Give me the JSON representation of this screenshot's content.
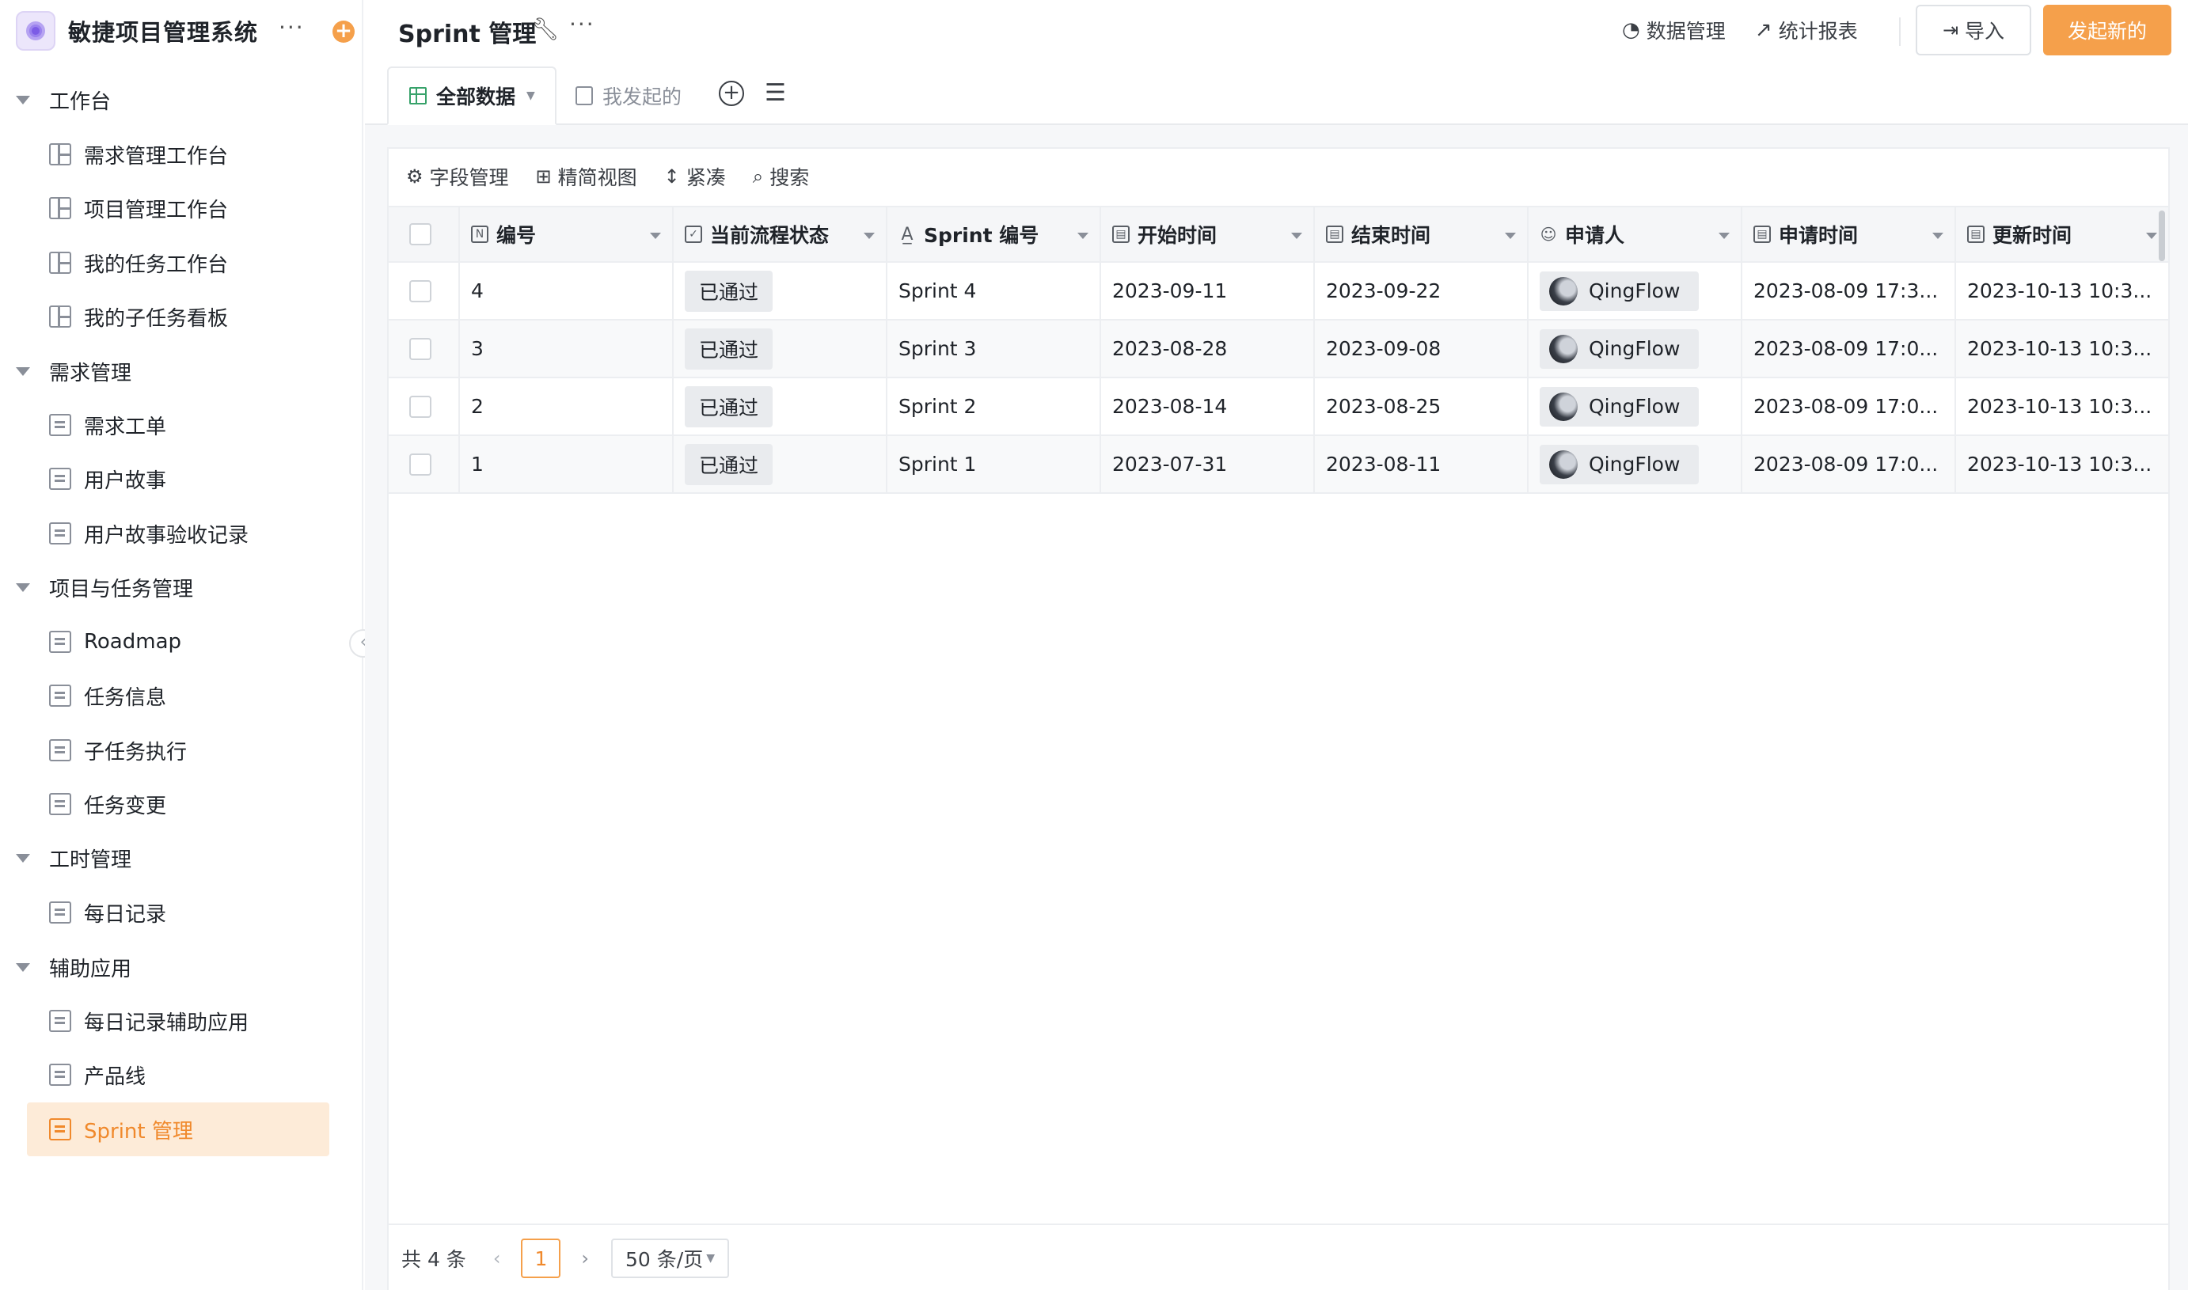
{
  "app": {
    "title": "敏捷项目管理系统",
    "more": "···",
    "add": "+"
  },
  "sidebar": {
    "groups": [
      {
        "label": "工作台"
      },
      {
        "label": "需求管理"
      },
      {
        "label": "项目与任务管理"
      },
      {
        "label": "工时管理"
      },
      {
        "label": "辅助应用"
      }
    ],
    "items": [
      {
        "label": "需求管理工作台",
        "icon": "dashboard-icon"
      },
      {
        "label": "项目管理工作台",
        "icon": "dashboard-icon"
      },
      {
        "label": "我的任务工作台",
        "icon": "dashboard-icon"
      },
      {
        "label": "我的子任务看板",
        "icon": "dashboard-icon"
      },
      {
        "label": "需求工单",
        "icon": "form-icon"
      },
      {
        "label": "用户故事",
        "icon": "form-icon"
      },
      {
        "label": "用户故事验收记录",
        "icon": "form-icon"
      },
      {
        "label": "Roadmap",
        "icon": "form-icon"
      },
      {
        "label": "任务信息",
        "icon": "form-icon"
      },
      {
        "label": "子任务执行",
        "icon": "form-icon"
      },
      {
        "label": "任务变更",
        "icon": "form-icon"
      },
      {
        "label": "每日记录",
        "icon": "form-icon"
      },
      {
        "label": "每日记录辅助应用",
        "icon": "form-icon"
      },
      {
        "label": "产品线",
        "icon": "form-icon"
      },
      {
        "label": "Sprint 管理",
        "icon": "form-icon",
        "active": true
      }
    ],
    "collapse": "‹"
  },
  "header": {
    "title": "Sprint 管理",
    "data_manage": "数据管理",
    "report": "统计报表",
    "import": "导入",
    "create": "发起新的"
  },
  "tabs": {
    "all_data": "全部数据",
    "mine": "我发起的"
  },
  "toolbar": {
    "fields": "字段管理",
    "compact_view": "精简视图",
    "density": "紧凑",
    "search": "搜索"
  },
  "table": {
    "columns": [
      "编号",
      "当前流程状态",
      "Sprint 编号",
      "开始时间",
      "结束时间",
      "申请人",
      "申请时间",
      "更新时间"
    ],
    "rows": [
      {
        "id": "4",
        "status": "已通过",
        "sprint": "Sprint 4",
        "start": "2023-09-11",
        "end": "2023-09-22",
        "applicant": "QingFlow",
        "applied": "2023-08-09 17:3...",
        "updated": "2023-10-13 10:3..."
      },
      {
        "id": "3",
        "status": "已通过",
        "sprint": "Sprint 3",
        "start": "2023-08-28",
        "end": "2023-09-08",
        "applicant": "QingFlow",
        "applied": "2023-08-09 17:0...",
        "updated": "2023-10-13 10:3..."
      },
      {
        "id": "2",
        "status": "已通过",
        "sprint": "Sprint 2",
        "start": "2023-08-14",
        "end": "2023-08-25",
        "applicant": "QingFlow",
        "applied": "2023-08-09 17:0...",
        "updated": "2023-10-13 10:3..."
      },
      {
        "id": "1",
        "status": "已通过",
        "sprint": "Sprint 1",
        "start": "2023-07-31",
        "end": "2023-08-11",
        "applicant": "QingFlow",
        "applied": "2023-08-09 17:0...",
        "updated": "2023-10-13 10:3..."
      }
    ]
  },
  "pagination": {
    "total": "共 4 条",
    "current": "1",
    "page_size": "50 条/页"
  },
  "colors": {
    "accent": "#f5a04b",
    "active_bg": "#fdebd8",
    "active_text": "#f0892c"
  }
}
